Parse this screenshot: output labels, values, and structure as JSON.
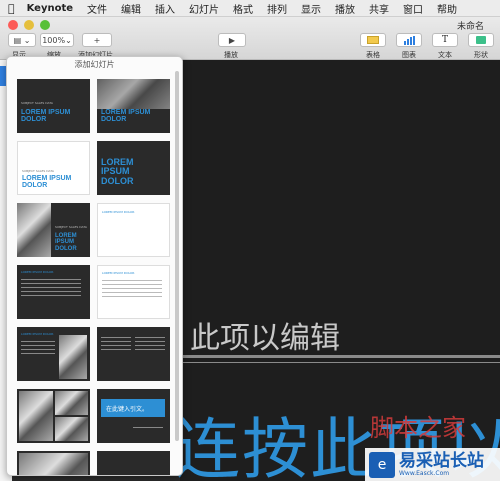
{
  "menubar": {
    "app": "Keynote",
    "items": [
      "文件",
      "编辑",
      "插入",
      "幻灯片",
      "格式",
      "排列",
      "显示",
      "播放",
      "共享",
      "窗口",
      "帮助"
    ]
  },
  "window": {
    "title": "未命名"
  },
  "toolbar": {
    "view_label": "显示",
    "zoom_value": "100%",
    "zoom_label": "缩放",
    "add_slide_label": "添加幻灯片",
    "play_label": "播放",
    "table_label": "表格",
    "chart_label": "图表",
    "text_label": "文本",
    "shape_label": "形状"
  },
  "popover": {
    "title": "添加幻灯片",
    "thumbs": [
      {
        "small": "SUBJECT SALES DATA",
        "big": "LOREM IPSUM DOLOR"
      },
      {
        "small": "",
        "big": "LOREM IPSUM DOLOR"
      },
      {
        "small": "SUBJECT SALES DATA",
        "big": "LOREM IPSUM DOLOR"
      },
      {
        "small": "",
        "big": "LOREM IPSUM DOLOR"
      },
      {
        "small": "SUBJECT SALES DATA",
        "big": "LOREM IPSUM DOLOR"
      },
      {
        "small": "LOREM IPSUM DOLOR",
        "big": ""
      },
      {
        "small": "LOREM IPSUM DOLOR",
        "big": ""
      },
      {
        "small": "LOREM IPSUM DOLOR",
        "big": ""
      },
      {
        "small": "LOREM IPSUM DOLOR",
        "big": ""
      },
      {
        "small": "",
        "big": ""
      },
      {
        "small": "",
        "big": "在此键入引文。"
      },
      {
        "small": "",
        "big": ""
      }
    ]
  },
  "canvas": {
    "hint": "此项以编辑",
    "big_text": "连按此项以"
  },
  "watermark": {
    "top": "脚本之家",
    "logo_text": "易采站长站",
    "url": "Www.Easck.Com"
  },
  "colors": {
    "accent_blue": "#2d8fd4",
    "canvas_bg": "#1e1e1e"
  }
}
